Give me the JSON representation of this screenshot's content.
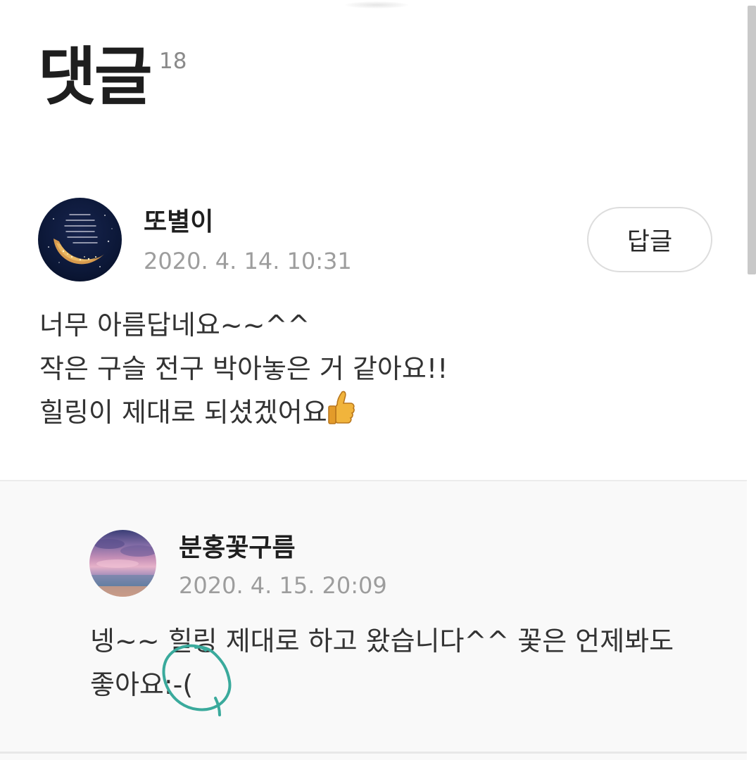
{
  "header": {
    "title": "댓글",
    "count": "18"
  },
  "comments": [
    {
      "author": "또별이",
      "timestamp": "2020. 4. 14. 10:31",
      "reply_label": "답글",
      "avatar_icon": "crescent-moon-night-avatar",
      "lines": [
        "너무 아름답네요~~^^",
        "작은 구슬 전구 박아놓은 거 같아요!!",
        "힐링이 제대로 되셨겠어요"
      ],
      "trailing_icon": "thumbs-up-icon"
    }
  ],
  "replies": [
    {
      "author": "분홍꽃구름",
      "timestamp": "2020. 4. 15. 20:09",
      "avatar_icon": "pink-sunset-sky-avatar",
      "lines": [
        "넹~~ 힐링 제대로 하고 왔습니다^^ 꽃은 언제봐도",
        "좋아요:-("
      ]
    }
  ],
  "annotation": {
    "type": "hand-drawn-circle",
    "color": "#3aaa9c"
  },
  "colors": {
    "background": "#ffffff",
    "reply_background": "#f9f9f9",
    "timestamp": "#9d9d9d",
    "title": "#1e1e1e"
  }
}
